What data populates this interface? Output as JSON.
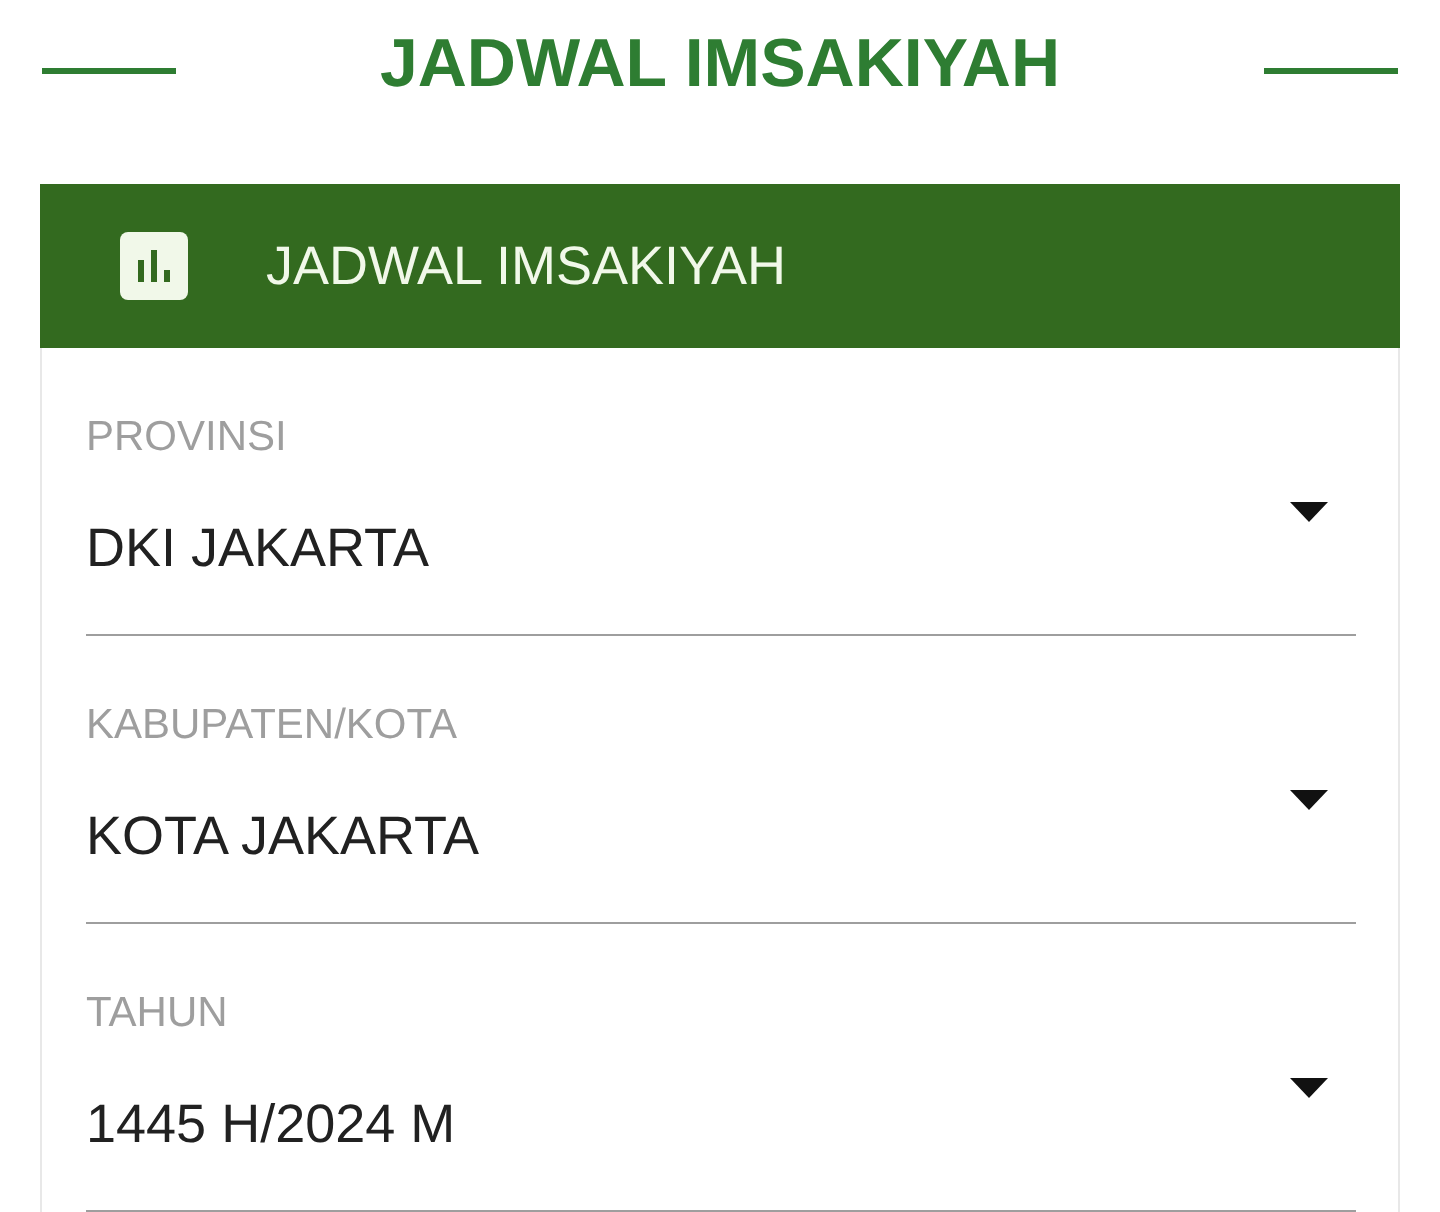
{
  "page_title": "JADWAL IMSAKIYAH",
  "card": {
    "title": "JADWAL IMSAKIYAH",
    "fields": [
      {
        "label": "PROVINSI",
        "value": "DKI JAKARTA"
      },
      {
        "label": "KABUPATEN/KOTA",
        "value": "KOTA JAKARTA"
      },
      {
        "label": "TAHUN",
        "value": "1445 H/2024 M"
      }
    ]
  }
}
